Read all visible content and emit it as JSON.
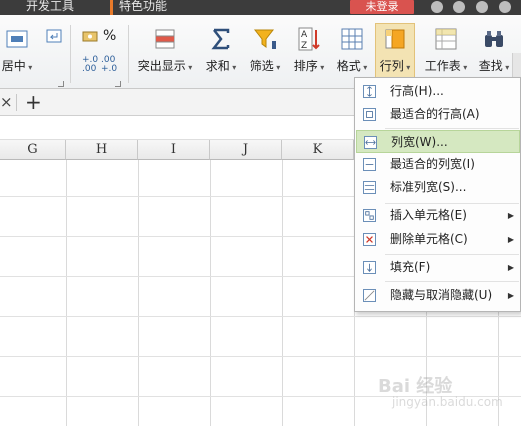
{
  "topbar": {
    "tab_dev": "开发工具",
    "tab_special": "特色功能",
    "login": "未登录"
  },
  "ribbon": {
    "merge_center": "居中",
    "highlight": "突出显示",
    "sum": "求和",
    "filter": "筛选",
    "sort": "排序",
    "format": "格式",
    "column": "行列",
    "worksheet": "工作表",
    "find": "查找",
    "percent": "%",
    "dec_inc": "+.0\n.00",
    "dec_dec": ".00\n+.0"
  },
  "tabs": {
    "close": "×",
    "new": "+"
  },
  "columns": [
    "G",
    "H",
    "I",
    "J",
    "K"
  ],
  "menu": {
    "items": [
      {
        "label": "行高(H)...",
        "icon": "row-height-icon",
        "submenu": false
      },
      {
        "label": "最适合的行高(A)",
        "icon": "autofit-row-icon",
        "submenu": false
      },
      {
        "label": "列宽(W)...",
        "icon": "column-width-icon",
        "submenu": false,
        "highlighted": true
      },
      {
        "label": "最适合的列宽(I)",
        "icon": "autofit-column-icon",
        "submenu": false
      },
      {
        "label": "标准列宽(S)...",
        "icon": "standard-width-icon",
        "submenu": false
      },
      {
        "label": "插入单元格(E)",
        "icon": "insert-cells-icon",
        "submenu": true
      },
      {
        "label": "删除单元格(C)",
        "icon": "delete-cells-icon",
        "submenu": true
      },
      {
        "label": "填充(F)",
        "icon": "fill-icon",
        "submenu": true
      },
      {
        "label": "隐藏与取消隐藏(U)",
        "icon": "hide-unhide-icon",
        "submenu": true
      }
    ]
  },
  "watermark": {
    "main": "Bai 经验",
    "sub": "jingyan.baidu.com"
  },
  "colors": {
    "accent_orange": "#e87a2a",
    "login_red": "#d9534f",
    "menu_highlight": "#d5e8c1"
  }
}
